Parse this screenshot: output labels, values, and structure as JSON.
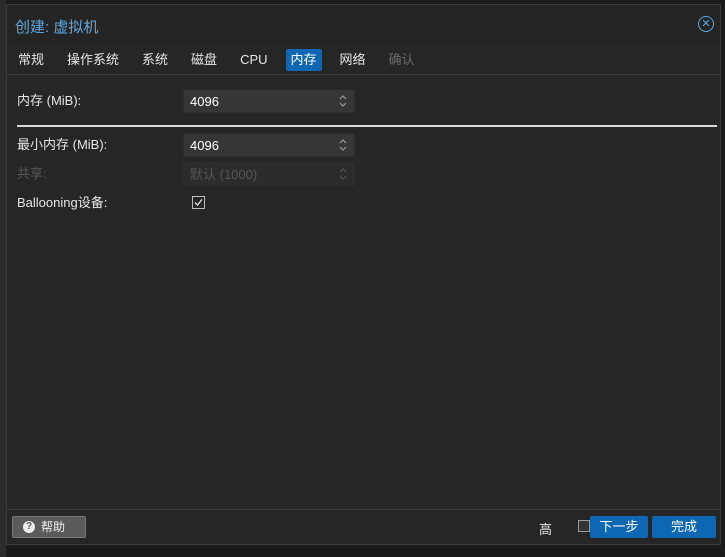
{
  "dialog": {
    "title": "创建: 虚拟机",
    "close_icon": "close-circle-icon"
  },
  "tabs": [
    {
      "label": "常规",
      "state": "normal"
    },
    {
      "label": "操作系统",
      "state": "normal"
    },
    {
      "label": "系统",
      "state": "normal"
    },
    {
      "label": "磁盘",
      "state": "normal"
    },
    {
      "label": "CPU",
      "state": "normal"
    },
    {
      "label": "内存",
      "state": "active"
    },
    {
      "label": "网络",
      "state": "normal"
    },
    {
      "label": "确认",
      "state": "disabled"
    }
  ],
  "form": {
    "memory": {
      "label": "内存 (MiB):",
      "value": "4096"
    },
    "min_memory": {
      "label": "最小内存 (MiB):",
      "value": "4096"
    },
    "shares": {
      "label": "共享:",
      "value": "默认 (1000)",
      "disabled": true
    },
    "ballooning": {
      "label": "Ballooning设备:",
      "checked": true
    }
  },
  "footer": {
    "help_label": "帮助",
    "help_icon": "question-circle-icon",
    "advanced_label": "高",
    "next_label": "下一步",
    "finish_label": "完成"
  },
  "colors": {
    "accent": "#0e67b2",
    "title": "#5ea8e0",
    "background": "#262626"
  }
}
